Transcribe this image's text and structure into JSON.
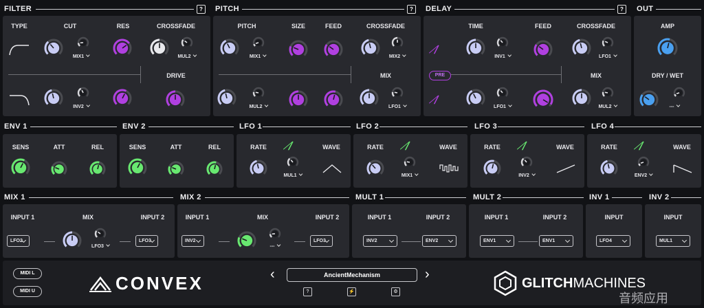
{
  "colors": {
    "accent_purple": "#b040e0",
    "accent_green": "#68e870",
    "accent_blue": "#4aa0f0",
    "knob_lavender": "#c8ccf4",
    "panel": "#28292e",
    "background": "#111215"
  },
  "sections": {
    "filter": "FILTER",
    "pitch": "PITCH",
    "delay": "DELAY",
    "out": "OUT",
    "env1": "ENV 1",
    "env2": "ENV 2",
    "lfo1": "LFO 1",
    "lfo2": "LFO 2",
    "lfo3": "LFO 3",
    "lfo4": "LFO 4",
    "mix1": "MIX 1",
    "mix2": "MIX 2",
    "mult1": "MULT 1",
    "mult2": "MULT 2",
    "inv1": "INV 1",
    "inv2": "INV 2"
  },
  "help_label": "?",
  "filter": {
    "type": "TYPE",
    "cut": "CUT",
    "res": "RES",
    "crossfade": "CROSSFADE",
    "drive": "DRIVE",
    "mod1": "MIX1",
    "mod2": "MUL2",
    "mod3": "INV2"
  },
  "pitch": {
    "pitch": "PITCH",
    "size": "SIZE",
    "feed": "FEED",
    "crossfade": "CROSSFADE",
    "mix": "MIX",
    "mod1": "MIX1",
    "mod2": "MIX2",
    "mod3": "MUL2",
    "mod4": "LFO1"
  },
  "delay": {
    "time": "TIME",
    "feed": "FEED",
    "crossfade": "CROSSFADE",
    "mix": "MIX",
    "pre": "PRE",
    "mod1": "INV1",
    "mod2": "LFO1",
    "mod3": "LFO1",
    "mod4": "MUL2"
  },
  "out": {
    "amp": "AMP",
    "drywet": "DRY / WET",
    "mod1": "---"
  },
  "env": {
    "sens": "SENS",
    "att": "ATT",
    "rel": "REL"
  },
  "lfo": {
    "rate": "RATE",
    "wave": "WAVE",
    "mod1": "MUL1",
    "mod2": "MIX1",
    "mod3": "INV2",
    "mod4": "ENV2"
  },
  "mix1": {
    "input1": "INPUT 1",
    "mix": "MIX",
    "input2": "INPUT 2",
    "in1": "LFO2",
    "mod": "LFO3",
    "in2": "LFO3"
  },
  "mix2": {
    "input1": "INPUT 1",
    "mix": "MIX",
    "input2": "INPUT 2",
    "in1": "INV2",
    "mod": "---",
    "in2": "LFO3"
  },
  "mult1": {
    "input1": "INPUT 1",
    "input2": "INPUT 2",
    "in1": "INV2",
    "in2": "ENV2"
  },
  "mult2": {
    "input1": "INPUT 1",
    "input2": "INPUT 2",
    "in1": "ENV1",
    "in2": "ENV1"
  },
  "inv1": {
    "input": "INPUT",
    "in": "LFO4"
  },
  "inv2": {
    "input": "INPUT",
    "in": "MUL1"
  },
  "footer": {
    "midi_l": "MIDI L",
    "midi_u": "MIDI U",
    "preset": "AncientMechanism",
    "prev": "‹",
    "next": "›",
    "brand": "CONVEX",
    "maker_bold": "GLITCH",
    "maker_light": "MACHINES",
    "watermark": "音频应用"
  },
  "icons": {
    "help": "help-icon",
    "prev": "chevron-left-icon",
    "next": "chevron-right-icon",
    "tempo": "tempo-sync-icon",
    "save": "save-icon",
    "settings": "settings-icon"
  }
}
